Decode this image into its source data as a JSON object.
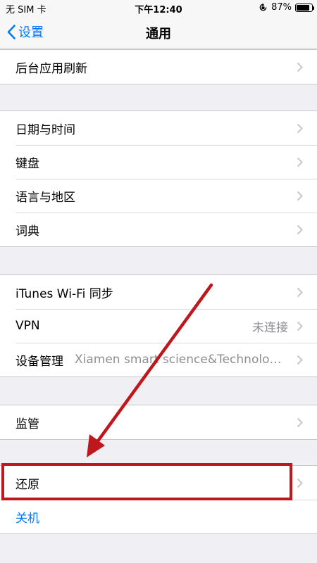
{
  "status_bar": {
    "carrier": "无 SIM 卡",
    "time": "下午12:40",
    "battery": "87%",
    "battery_level": 0.87
  },
  "nav": {
    "back_label": "设置",
    "title": "通用"
  },
  "groups": [
    {
      "items": [
        {
          "label": "后台应用刷新"
        }
      ]
    },
    {
      "items": [
        {
          "label": "日期与时间"
        },
        {
          "label": "键盘"
        },
        {
          "label": "语言与地区"
        },
        {
          "label": "词典"
        }
      ]
    },
    {
      "items": [
        {
          "label": "iTunes Wi-Fi 同步"
        },
        {
          "label": "VPN",
          "detail": "未连接"
        },
        {
          "label": "设备管理",
          "detail": "Xiamen smart science&Technolog..."
        }
      ]
    },
    {
      "items": [
        {
          "label": "监管"
        }
      ]
    },
    {
      "items": [
        {
          "label": "还原"
        },
        {
          "label": "关机"
        }
      ]
    }
  ],
  "colors": {
    "accent": "#007aff",
    "annotation": "#c0171d",
    "background": "#efeff4"
  }
}
